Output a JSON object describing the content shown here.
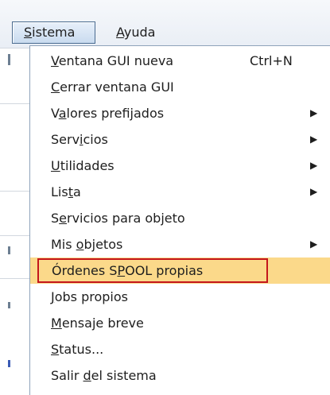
{
  "menubar": {
    "sistema": {
      "pre": "",
      "u": "S",
      "post": "istema"
    },
    "ayuda": {
      "pre": "",
      "u": "A",
      "post": "yuda"
    }
  },
  "menu": {
    "items": [
      {
        "pre": "",
        "u": "V",
        "post": "entana GUI nueva",
        "shortcut": "Ctrl+N",
        "arrow": ""
      },
      {
        "pre": "",
        "u": "C",
        "post": "errar ventana GUI",
        "shortcut": "",
        "arrow": ""
      },
      {
        "pre": "V",
        "u": "a",
        "post": "lores prefijados",
        "shortcut": "",
        "arrow": "▶"
      },
      {
        "pre": "Serv",
        "u": "i",
        "post": "cios",
        "shortcut": "",
        "arrow": "▶"
      },
      {
        "pre": "",
        "u": "U",
        "post": "tilidades",
        "shortcut": "",
        "arrow": "▶"
      },
      {
        "pre": "Lis",
        "u": "t",
        "post": "a",
        "shortcut": "",
        "arrow": "▶"
      },
      {
        "pre": "S",
        "u": "e",
        "post": "rvicios para objeto",
        "shortcut": "",
        "arrow": ""
      },
      {
        "pre": "Mis ",
        "u": "o",
        "post": "bjetos",
        "shortcut": "",
        "arrow": "▶"
      },
      {
        "pre": "Órdenes S",
        "u": "P",
        "post": "OOL propias",
        "shortcut": "",
        "arrow": ""
      },
      {
        "pre": "",
        "u": "J",
        "post": "obs propios",
        "shortcut": "",
        "arrow": ""
      },
      {
        "pre": "",
        "u": "M",
        "post": "ensaje breve",
        "shortcut": "",
        "arrow": ""
      },
      {
        "pre": "",
        "u": "S",
        "post": "tatus...",
        "shortcut": "",
        "arrow": ""
      },
      {
        "pre": "Salir ",
        "u": "d",
        "post": "el sistema",
        "shortcut": "",
        "arrow": ""
      }
    ]
  },
  "colors": {
    "highlight_bg": "#fbd98a",
    "highlight_border": "#c4161c"
  }
}
